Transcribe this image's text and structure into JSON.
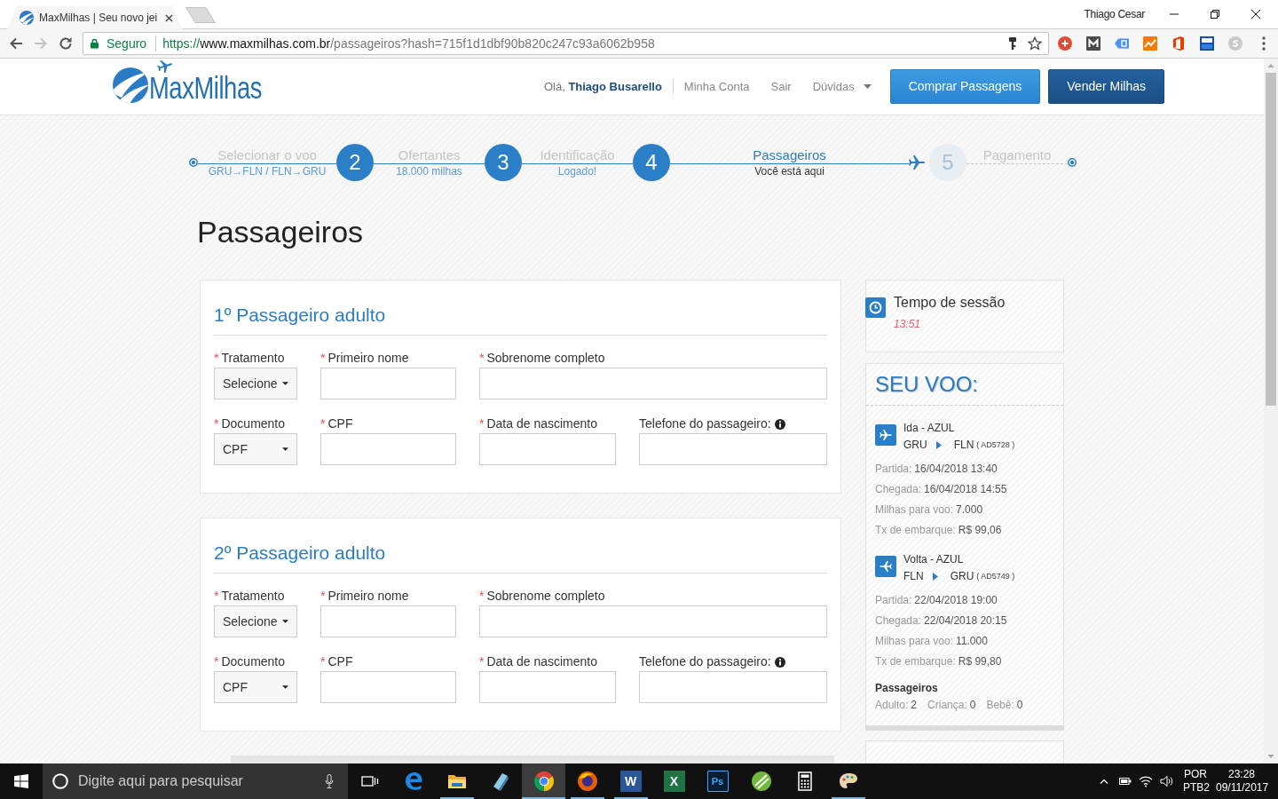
{
  "browser": {
    "tabs": [
      {
        "title": "MaxMilhas | Seu novo jei",
        "selected": true
      }
    ],
    "profile_name": "Thiago Cesar",
    "nav_buttons": [
      {
        "kind": "back",
        "disabled": false
      },
      {
        "kind": "forward",
        "disabled": true
      },
      {
        "kind": "reload",
        "disabled": false
      }
    ],
    "security_label": "Seguro",
    "url": {
      "scheme": "https://",
      "host": "www.maxmilhas.com.br",
      "path": "/passageiros?hash=715f1d1dbf90b820c247c93a6062b958"
    }
  },
  "site_header": {
    "logo": "MaxMilhas",
    "greeting": "Olá, **Thiago Busarello**",
    "links": [
      {
        "label": "Minha Conta",
        "dropdown": false
      },
      {
        "label": "Sair",
        "dropdown": false
      },
      {
        "label": "Dúvidas",
        "dropdown": true
      }
    ],
    "buttons": [
      {
        "label": "Comprar Passagens",
        "kind": "primary"
      },
      {
        "label": "Vender Milhas",
        "kind": "secondary"
      }
    ]
  },
  "steps": [
    {
      "title": "Selecionar o voo",
      "subtitle": "GRU→FLN / FLN→GRU",
      "completed": true,
      "selected": false
    },
    {
      "number": "2",
      "title": "Ofertantes",
      "subtitle": "18.000 milhas",
      "completed": true,
      "selected": false
    },
    {
      "number": "3",
      "title": "Identificação",
      "subtitle": "Logado!",
      "completed": true,
      "selected": false
    },
    {
      "number": "4",
      "title": "Passageiros",
      "subtitle": "Você está aqui",
      "completed": false,
      "selected": true
    },
    {
      "number": "5",
      "title": "Pagamento",
      "completed": false,
      "selected": false
    }
  ],
  "page_title": "Passageiros",
  "passenger_forms": [
    {
      "heading": "1º Passageiro adulto",
      "rows": [
        [
          {
            "label": "Tratamento",
            "required_mark": "*",
            "kind": "select",
            "value": "Selecione"
          },
          {
            "label": "Primeiro nome",
            "required_mark": "*",
            "kind": "text"
          },
          {
            "label": "Sobrenome completo",
            "required_mark": "*",
            "kind": "text"
          }
        ],
        [
          {
            "label": "Documento",
            "required_mark": "*",
            "kind": "select",
            "value": "CPF"
          },
          {
            "label": "CPF",
            "required_mark": "*",
            "kind": "text"
          },
          {
            "label": "Data de nascimento",
            "required_mark": "*",
            "kind": "text"
          },
          {
            "label": "Telefone do passageiro:",
            "kind": "text",
            "info": true
          }
        ]
      ]
    },
    {
      "heading": "2º Passageiro adulto",
      "rows": [
        [
          {
            "label": "Tratamento",
            "required_mark": "*",
            "kind": "select",
            "value": "Selecione"
          },
          {
            "label": "Primeiro nome",
            "required_mark": "*",
            "kind": "text"
          },
          {
            "label": "Sobrenome completo",
            "required_mark": "*",
            "kind": "text"
          }
        ],
        [
          {
            "label": "Documento",
            "required_mark": "*",
            "kind": "select",
            "value": "CPF"
          },
          {
            "label": "CPF",
            "required_mark": "*",
            "kind": "text"
          },
          {
            "label": "Data de nascimento",
            "required_mark": "*",
            "kind": "text"
          },
          {
            "label": "Telefone do passageiro:",
            "kind": "text",
            "info": true
          }
        ]
      ]
    }
  ],
  "session": {
    "title": "Tempo de sessão",
    "time": "13:51"
  },
  "flight_summary": {
    "title": "SEU VOO:",
    "legs": [
      {
        "kind": "outbound",
        "title": "Ida - AZUL",
        "from": "GRU",
        "to": "FLN",
        "flight_code": "( AD5728 )",
        "details": [
          {
            "label": "Partida:",
            "value": "16/04/2018 13:40"
          },
          {
            "label": "Chegada:",
            "value": "16/04/2018 14:55"
          },
          {
            "label": "Milhas para voo:",
            "value": "7.000"
          },
          {
            "label": "Tx de embarque:",
            "value": "R$ 99,06"
          }
        ]
      },
      {
        "kind": "return",
        "title": "Volta - AZUL",
        "from": "FLN",
        "to": "GRU",
        "flight_code": "( AD5749 )",
        "details": [
          {
            "label": "Partida:",
            "value": "22/04/2018 19:00"
          },
          {
            "label": "Chegada:",
            "value": "22/04/2018 20:15"
          },
          {
            "label": "Milhas para voo:",
            "value": "11.000"
          },
          {
            "label": "Tx de embarque:",
            "value": "R$ 99,80"
          }
        ]
      }
    ],
    "passengers_title": "Passageiros",
    "passenger_counts": [
      {
        "label": "Adulto:",
        "value": "2"
      },
      {
        "label": "Criança:",
        "value": "0"
      },
      {
        "label": "Bebê:",
        "value": "0"
      }
    ]
  },
  "taskbar": {
    "search": {
      "placeholder": "Digite aqui para pesquisar"
    },
    "apps": [
      {
        "kind": "edge",
        "running": false,
        "selected": false
      },
      {
        "kind": "explorer",
        "running": true,
        "selected": false
      },
      {
        "kind": "app",
        "running": false,
        "selected": false
      },
      {
        "kind": "chrome",
        "running": true,
        "selected": true
      },
      {
        "kind": "firefox",
        "running": true,
        "selected": false
      },
      {
        "kind": "word",
        "glyph": "W",
        "running": true,
        "selected": false
      },
      {
        "kind": "excel",
        "glyph": "X",
        "running": false,
        "selected": false
      },
      {
        "kind": "photoshop",
        "glyph": "Ps",
        "running": false,
        "selected": false
      },
      {
        "kind": "graphic",
        "running": false,
        "selected": false
      },
      {
        "kind": "calculator",
        "running": false,
        "selected": false
      },
      {
        "kind": "paint",
        "running": true,
        "selected": false
      }
    ],
    "language": "POR",
    "keyboard": "PTB2",
    "time": "23:28",
    "date": "09/11/2017"
  }
}
